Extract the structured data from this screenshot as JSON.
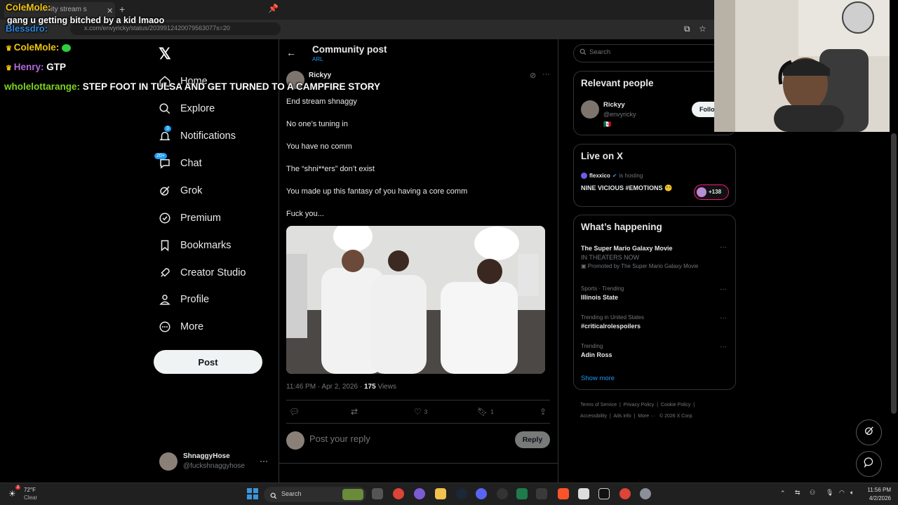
{
  "browser": {
    "tab_title": "Community stream s",
    "url": "x.com/envyricky/status/2039912420079563077s=20"
  },
  "chat_overlay": [
    {
      "user": "ColeMole:",
      "message": "",
      "user_color": "#f1c40f"
    },
    {
      "user": "",
      "message": "gang u getting bitched by a kid lmaoo",
      "user_color": "#ffffff"
    },
    {
      "user": "Blessdro:",
      "message": "",
      "user_color": "#2e86de"
    },
    {
      "user": "ColeMole:",
      "message": "",
      "user_color": "#f1c40f"
    },
    {
      "user": "Henry:",
      "message": "GTP",
      "user_color": "#b06ad9"
    },
    {
      "user": "wholelottarange:",
      "message": "STEP FOOT IN TULSA AND GET TURNED TO A CAMPFIRE STORY",
      "user_color": "#7ed321"
    }
  ],
  "nav": {
    "items": [
      {
        "label": "Home",
        "icon": "home-icon"
      },
      {
        "label": "Explore",
        "icon": "search-icon"
      },
      {
        "label": "Notifications",
        "icon": "bell-icon",
        "badge": "3"
      },
      {
        "label": "Chat",
        "icon": "chat-icon",
        "badge": "20+"
      },
      {
        "label": "Grok",
        "icon": "grok-icon"
      },
      {
        "label": "Premium",
        "icon": "premium-icon"
      },
      {
        "label": "Bookmarks",
        "icon": "bookmark-icon"
      },
      {
        "label": "Creator Studio",
        "icon": "rocket-icon"
      },
      {
        "label": "Profile",
        "icon": "person-icon"
      },
      {
        "label": "More",
        "icon": "more-icon"
      }
    ],
    "post_label": "Post",
    "account_name": "ShnaggyHose",
    "account_handle": "@fuckshnaggyhose"
  },
  "post": {
    "header_title": "Community post",
    "header_sub": "ARL",
    "author": "Rickyy",
    "lines": [
      "End stream shnaggy",
      "No one’s tuning in",
      "You have no comm",
      "The “shni**ers” don’t exist",
      " You made up this fantasy of you having a core comm",
      "Fuck you..."
    ],
    "time": "11:46 PM · Apr 2, 2026 · ",
    "views_count": "175",
    "views_label": " Views",
    "likes": "3",
    "bookmarks": "1",
    "reply_placeholder": "Post your reply",
    "reply_label": "Reply"
  },
  "right": {
    "search_placeholder": "Search",
    "relevant_title": "Relevant people",
    "person_name": "Rickyy",
    "person_handle": "@envyricky",
    "person_flag": "🇲🇽",
    "follow_label": "Follow",
    "live_title": "Live on X",
    "live_host": "flexxico",
    "live_status": "is hosting",
    "live_title_text": "NINE VICIOUS #EMOTIONS 😵‍💫",
    "live_count": "+138",
    "happening_title": "What’s happening",
    "trends": [
      {
        "context": "",
        "name": "The Super Mario Galaxy Movie",
        "sub": "IN THEATERS NOW",
        "promo": "Promoted by The Super Mario Galaxy Movie"
      },
      {
        "context": "Sports · Trending",
        "name": "Illinois State"
      },
      {
        "context": "Trending in United States",
        "name": "#criticalrolespoilers"
      },
      {
        "context": "Trending",
        "name": "Adin Ross"
      }
    ],
    "show_more": "Show more",
    "footer": [
      "Terms of Service",
      "Privacy Policy",
      "Cookie Policy",
      "Accessibility",
      "Ads info",
      "More ···",
      "© 2026 X Corp."
    ]
  },
  "taskbar": {
    "temp": "72°F",
    "condition": "Clear",
    "search_label": "Search",
    "time": "11:56 PM",
    "date": "4/2/2026",
    "weather_badge": "2"
  },
  "colors": {
    "accent": "#1d9bf0",
    "background": "#000000",
    "border": "#2f3336",
    "muted": "#71767b"
  }
}
